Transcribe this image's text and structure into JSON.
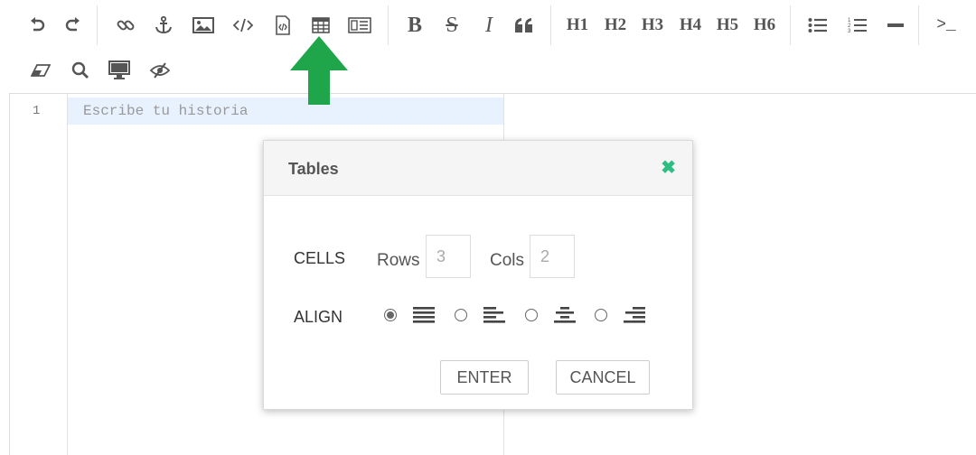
{
  "toolbar": {
    "row1_icons": [
      "undo-icon",
      "redo-icon",
      "link-icon",
      "anchor-icon",
      "image-icon",
      "code-icon",
      "html-file-icon",
      "table-icon",
      "html-entities-icon"
    ],
    "bold": "B",
    "strikethrough": "S",
    "italic": "I",
    "h1": "H1",
    "h2": "H2",
    "h3": "H3",
    "h4": "H4",
    "h5": "H5",
    "h6": "H6",
    "terminal": ">_",
    "row2_icons": [
      "eraser-icon",
      "search-icon",
      "monitor-icon",
      "eye-slash-icon"
    ]
  },
  "editor": {
    "line_number": "1",
    "placeholder": "Escribe tu historia"
  },
  "annotation": {
    "arrow_color": "#1fa64a"
  },
  "dialog": {
    "title": "Tables",
    "close": "✖",
    "cells_label": "CELLS",
    "rows_label": "Rows",
    "rows_placeholder": "3",
    "cols_label": "Cols",
    "cols_placeholder": "2",
    "align_label": "ALIGN",
    "align_options": [
      "justify",
      "left",
      "center",
      "right"
    ],
    "align_selected": "justify",
    "enter_label": "ENTER",
    "cancel_label": "CANCEL",
    "accent_color": "#2fbe82"
  }
}
